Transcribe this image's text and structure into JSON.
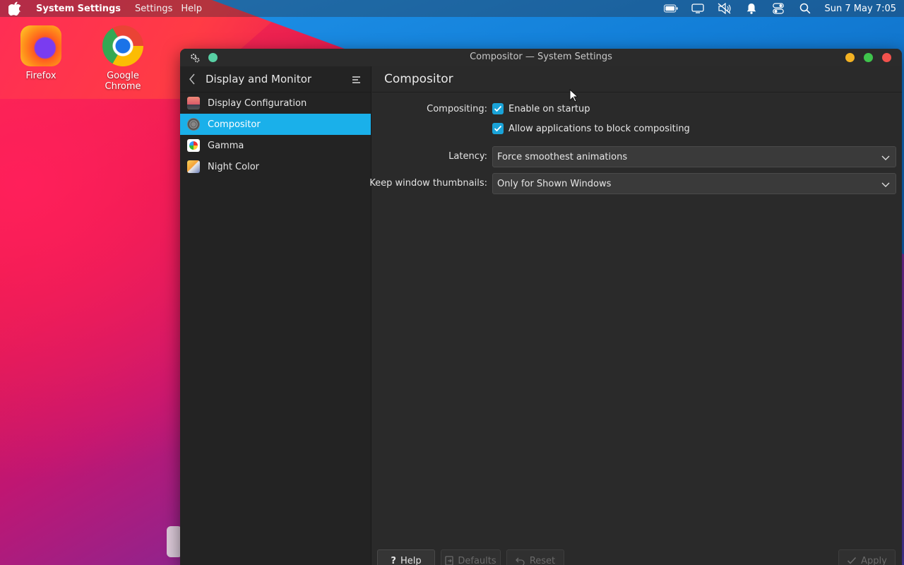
{
  "menubar": {
    "app_name": "System Settings",
    "menus": [
      "Settings",
      "Help"
    ],
    "clock": "Sun 7 May 7:05"
  },
  "desktop": {
    "icons": [
      {
        "label": "Firefox",
        "icon": "firefox-icon"
      },
      {
        "label": "Google Chrome",
        "icon": "chrome-icon"
      }
    ]
  },
  "window": {
    "title": "Compositor — System Settings",
    "sidebar": {
      "header": "Display and Monitor",
      "items": [
        {
          "label": "Display Configuration",
          "icon": "display-config-icon",
          "active": false
        },
        {
          "label": "Compositor",
          "icon": "compositor-icon",
          "active": true
        },
        {
          "label": "Gamma",
          "icon": "gamma-icon",
          "active": false
        },
        {
          "label": "Night Color",
          "icon": "night-color-icon",
          "active": false
        }
      ]
    },
    "page": {
      "title": "Compositor",
      "compositing_label": "Compositing:",
      "enable_on_startup": {
        "label": "Enable on startup",
        "checked": true
      },
      "allow_block": {
        "label": "Allow applications to block compositing",
        "checked": true
      },
      "latency_label": "Latency:",
      "latency_value": "Force smoothest animations",
      "thumbnails_label": "Keep window thumbnails:",
      "thumbnails_value": "Only for Shown Windows"
    },
    "buttons": {
      "help": "Help",
      "defaults": "Defaults",
      "reset": "Reset",
      "apply": "Apply"
    }
  },
  "colors": {
    "accent": "#1ab0ea",
    "window_bg": "#2a2a2a",
    "sidebar_bg": "#232323"
  }
}
